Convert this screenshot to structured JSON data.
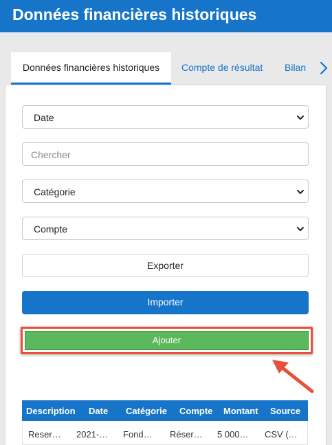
{
  "header": {
    "title": "Données financières historiques"
  },
  "tabs": [
    {
      "label": "Données financières historiques",
      "active": true
    },
    {
      "label": "Compte de résultat",
      "active": false
    },
    {
      "label": "Bilan",
      "active": false
    }
  ],
  "filters": {
    "date_select": "Date",
    "search_placeholder": "Chercher",
    "category_select": "Catégorie",
    "account_select": "Compte"
  },
  "buttons": {
    "export_label": "Exporter",
    "import_label": "Importer",
    "add_label": "Ajouter"
  },
  "table": {
    "columns": [
      "Description",
      "Date",
      "Catégorie",
      "Compte",
      "Montant",
      "Source"
    ],
    "rows": [
      [
        "Reser…",
        "2021-…",
        "Fond…",
        "Réser…",
        "5 000…",
        "CSV (…"
      ]
    ]
  },
  "colors": {
    "brand_blue": "#1675c9",
    "add_green": "#5cb85c",
    "highlight_red": "#e8503a"
  }
}
